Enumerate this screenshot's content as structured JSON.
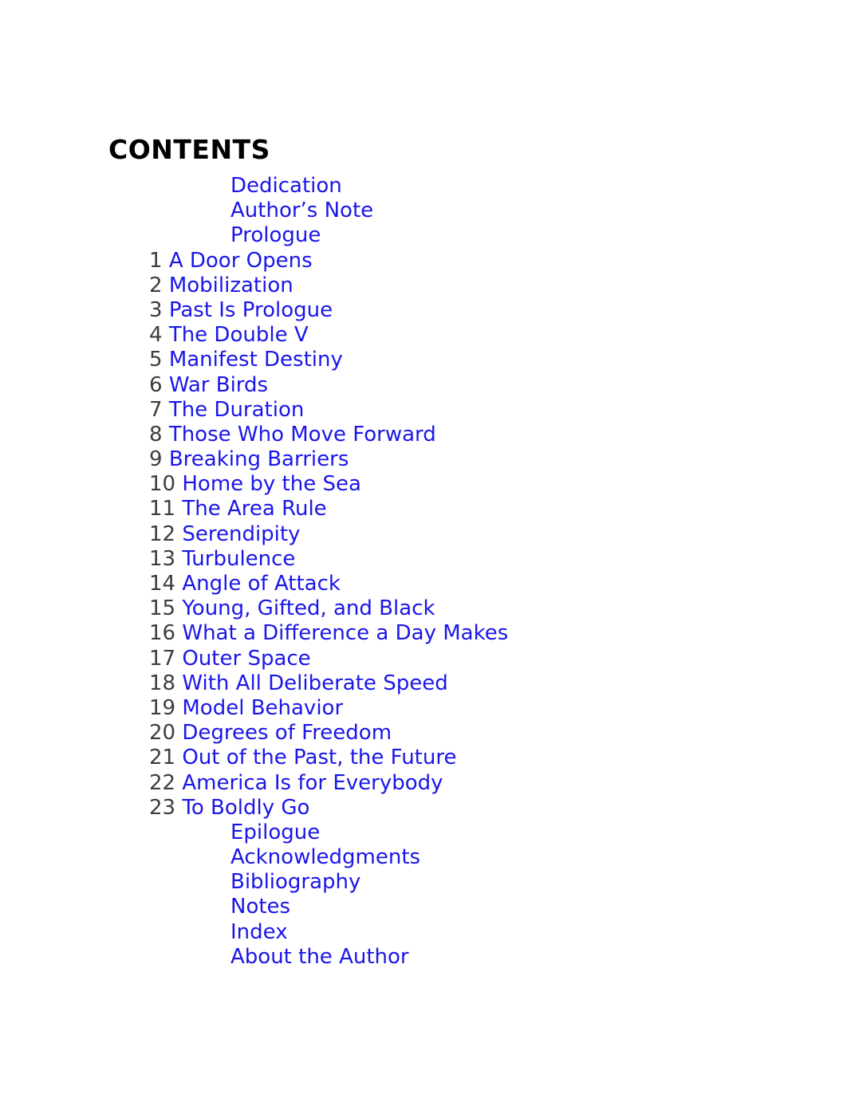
{
  "page": {
    "heading": "CONTENTS",
    "background_color": "#ffffff",
    "heading_color": "#000000",
    "link_color": "#1a16e8",
    "number_color": "#3d3d3d"
  },
  "front_matter": [
    {
      "title": "Dedication"
    },
    {
      "title": "Author’s Note"
    },
    {
      "title": "Prologue"
    }
  ],
  "chapters": [
    {
      "number": "1",
      "title": "A Door Opens"
    },
    {
      "number": "2",
      "title": "Mobilization"
    },
    {
      "number": "3",
      "title": "Past Is Prologue"
    },
    {
      "number": "4",
      "title": "The Double V"
    },
    {
      "number": "5",
      "title": "Manifest Destiny"
    },
    {
      "number": "6",
      "title": "War Birds"
    },
    {
      "number": "7",
      "title": "The Duration"
    },
    {
      "number": "8",
      "title": "Those Who Move Forward"
    },
    {
      "number": "9",
      "title": "Breaking Barriers"
    },
    {
      "number": "10",
      "title": "Home by the Sea"
    },
    {
      "number": "11",
      "title": "The Area Rule"
    },
    {
      "number": "12",
      "title": "Serendipity"
    },
    {
      "number": "13",
      "title": "Turbulence"
    },
    {
      "number": "14",
      "title": "Angle of Attack"
    },
    {
      "number": "15",
      "title": "Young, Gifted, and Black"
    },
    {
      "number": "16",
      "title": "What a Difference a Day Makes"
    },
    {
      "number": "17",
      "title": "Outer Space"
    },
    {
      "number": "18",
      "title": "With All Deliberate Speed"
    },
    {
      "number": "19",
      "title": "Model Behavior"
    },
    {
      "number": "20",
      "title": "Degrees of Freedom"
    },
    {
      "number": "21",
      "title": "Out of the Past, the Future"
    },
    {
      "number": "22",
      "title": "America Is for Everybody"
    },
    {
      "number": "23",
      "title": "To Boldly Go"
    }
  ],
  "back_matter": [
    {
      "title": "Epilogue"
    },
    {
      "title": "Acknowledgments"
    },
    {
      "title": "Bibliography"
    },
    {
      "title": "Notes"
    },
    {
      "title": "Index"
    },
    {
      "title": "About the Author"
    }
  ]
}
